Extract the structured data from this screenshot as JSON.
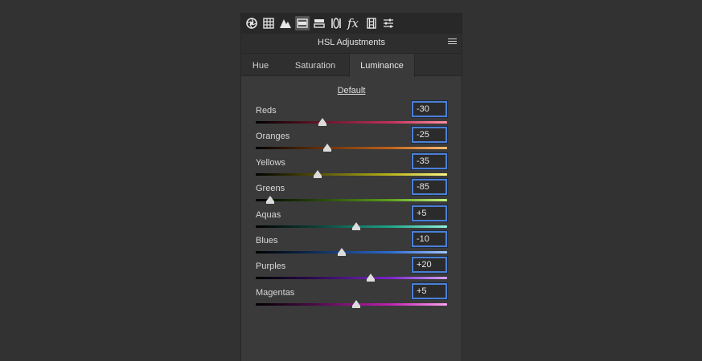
{
  "toolbar": {
    "icons": [
      "aperture-icon",
      "grid-icon",
      "mountain-icon",
      "hsl-panel-icon",
      "split-toning-icon",
      "lens-icon",
      "fx-icon",
      "film-icon",
      "sliders-icon"
    ]
  },
  "panel": {
    "title": "HSL Adjustments"
  },
  "tabs": [
    {
      "label": "Hue"
    },
    {
      "label": "Saturation"
    },
    {
      "label": "Luminance"
    }
  ],
  "default_label": "Default",
  "sliders": [
    {
      "label": "Reds",
      "value": "-30",
      "num": -30,
      "gradient": "linear-gradient(90deg,#000 0%,#5a1224 30%,#c0305a 70%,#ff8fa0 100%)"
    },
    {
      "label": "Oranges",
      "value": "-25",
      "num": -25,
      "gradient": "linear-gradient(90deg,#000 0%,#5a2a0a 30%,#c0601a 70%,#ffbf70 100%)"
    },
    {
      "label": "Yellows",
      "value": "-35",
      "num": -35,
      "gradient": "linear-gradient(90deg,#000 0%,#4e4a08 30%,#b7b21a 70%,#fff585 100%)"
    },
    {
      "label": "Greens",
      "value": "-85",
      "num": -85,
      "gradient": "linear-gradient(90deg,#000 0%,#233f08 30%,#5aa01a 70%,#c5f27e 100%)"
    },
    {
      "label": "Aquas",
      "value": "+5",
      "num": 5,
      "gradient": "linear-gradient(90deg,#000 0%,#0b3d33 30%,#1da38a 70%,#8ff2de 100%)"
    },
    {
      "label": "Blues",
      "value": "-10",
      "num": -10,
      "gradient": "linear-gradient(90deg,#000 0%,#0d2a54 30%,#2a6ad0 70%,#9fc4ff 100%)"
    },
    {
      "label": "Purples",
      "value": "+20",
      "num": 20,
      "gradient": "linear-gradient(90deg,#000 0%,#2b0a4f 30%,#7a24c8 70%,#d2a2ff 100%)"
    },
    {
      "label": "Magentas",
      "value": "+5",
      "num": 5,
      "gradient": "linear-gradient(90deg,#000 0%,#4a0a45 30%,#c020b0 70%,#ffa2f1 100%)"
    }
  ],
  "colors": {
    "background": "#323232",
    "panel": "#3a3a3a",
    "accent": "#4a7fd6"
  }
}
